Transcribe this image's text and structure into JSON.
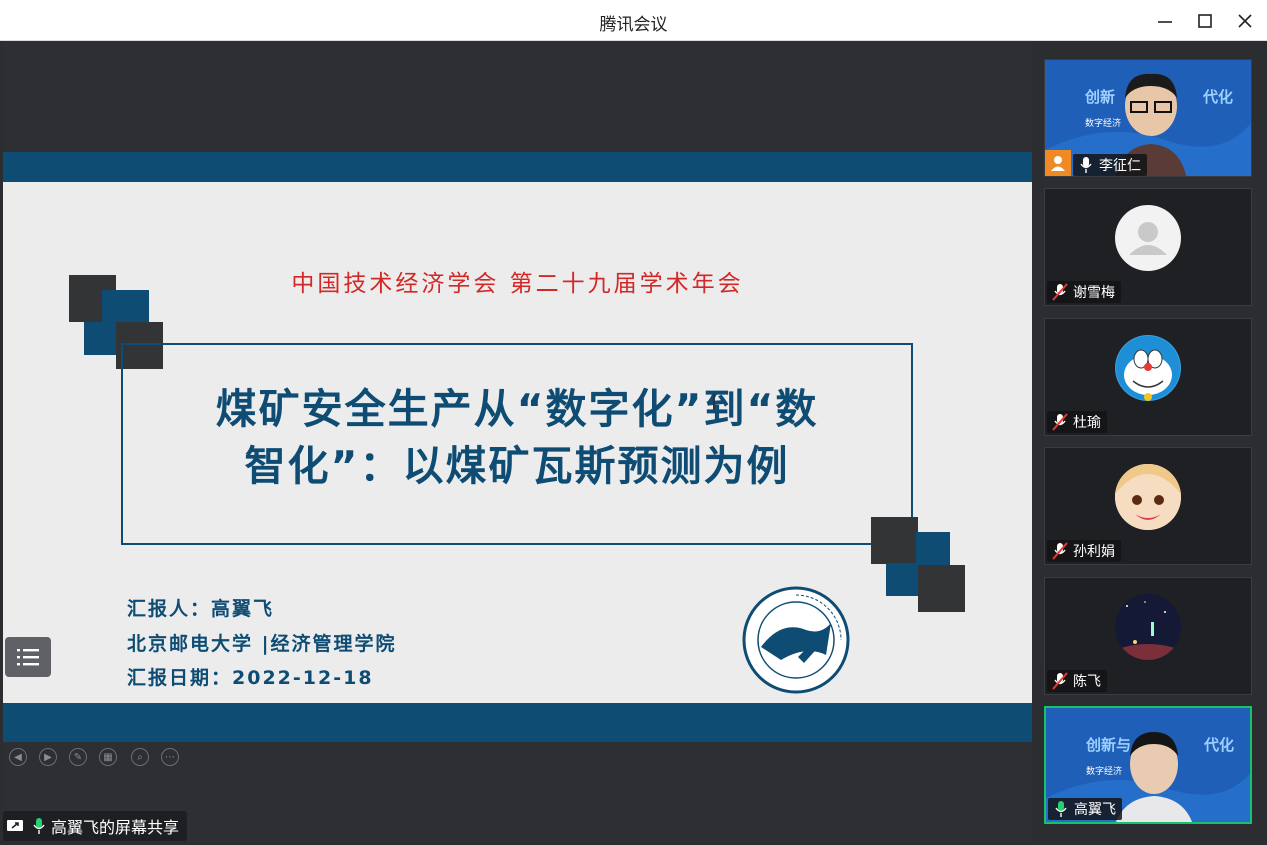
{
  "window": {
    "title": "腾讯会议",
    "minimize_icon": "minimize-icon",
    "maximize_icon": "maximize-icon",
    "close_icon": "close-icon"
  },
  "slide": {
    "conference": "中国技术经济学会 第二十九届学术年会",
    "title_line1": "煤矿安全生产从“数字化”到“数",
    "title_line2": "智化”：以煤矿瓦斯预测为例",
    "reporter": "汇报人：高翼飞",
    "affiliation": "北京邮电大学 |经济管理学院",
    "date": "汇报日期：2022-12-18",
    "logo_text": "UNIVERSITY OF POSTS AND TELECOMMUNICATIONS 北京邮电大学",
    "accent_color": "#0f4c74",
    "conference_color": "#d32828"
  },
  "share": {
    "label": "高翼飞的屏幕共享"
  },
  "participants": [
    {
      "name": "李征仁",
      "mic": "on",
      "video": true,
      "host": true,
      "video_text": "创新",
      "video_text2": "代化",
      "video_sub": "数字经济"
    },
    {
      "name": "谢雪梅",
      "mic": "muted",
      "video": false
    },
    {
      "name": "杜瑜",
      "mic": "muted",
      "video": false
    },
    {
      "name": "孙利娟",
      "mic": "muted",
      "video": false
    },
    {
      "name": "陈飞",
      "mic": "muted",
      "video": false
    },
    {
      "name": "高翼飞",
      "mic": "on",
      "video": true,
      "speaking": true,
      "video_text": "创新与",
      "video_text2": "代化",
      "video_sub": "数字经济"
    }
  ]
}
